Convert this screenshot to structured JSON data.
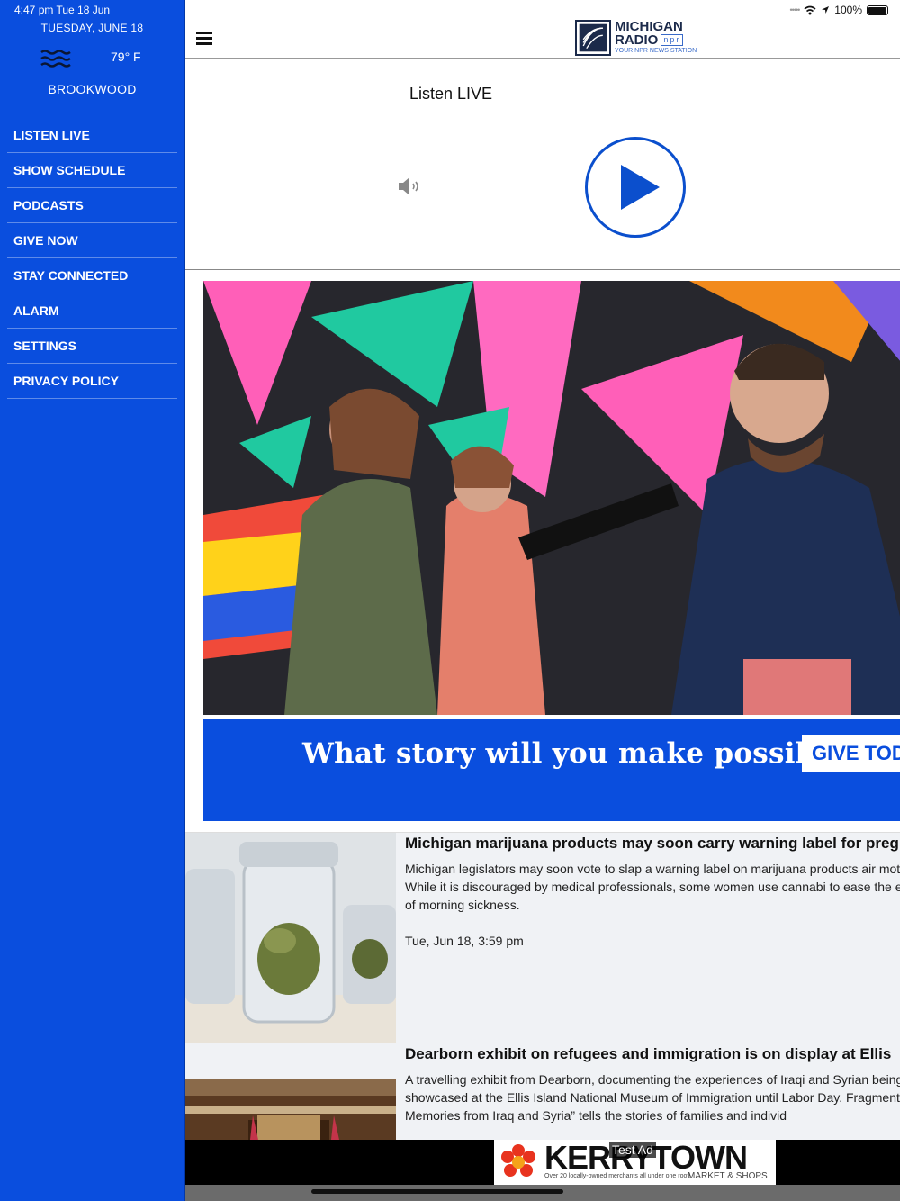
{
  "status_bar": {
    "time_date": "4:47 pm   Tue 18 Jun",
    "battery": "100%"
  },
  "sidebar": {
    "date": "TUESDAY, JUNE 18",
    "temperature": "79° F",
    "location": "BROOKWOOD",
    "weather_icon": "fog-icon",
    "menu": [
      {
        "label": "LISTEN LIVE"
      },
      {
        "label": "SHOW SCHEDULE"
      },
      {
        "label": "PODCASTS"
      },
      {
        "label": "GIVE NOW"
      },
      {
        "label": "STAY CONNECTED"
      },
      {
        "label": "ALARM"
      },
      {
        "label": "SETTINGS"
      },
      {
        "label": "PRIVACY POLICY"
      }
    ]
  },
  "header": {
    "logo_line1": "MICHIGAN",
    "logo_line2": "RADIO",
    "logo_npr": "npr",
    "logo_tagline": "YOUR NPR NEWS STATION"
  },
  "player": {
    "title": "Listen LIVE",
    "accent_color": "#0b4fcd"
  },
  "banner": {
    "headline": "What story will you make possible?",
    "button_label": "GIVE TOD"
  },
  "articles": [
    {
      "title": "Michigan marijuana products may soon carry warning label for preg",
      "summary": "Michigan legislators may soon vote to slap a warning label on marijuana products air mothers. While it is discouraged by medical professionals, some women use cannabi to ease the effects of morning sickness.",
      "date": "Tue, Jun 18, 3:59 pm"
    },
    {
      "title": "Dearborn exhibit on refugees and immigration is on display at Ellis",
      "summary": "A travelling exhibit from Dearborn, documenting the experiences of Iraqi and Syrian being showcased at the Ellis Island National Museum of Immigration until Labor Day. Fragments and Memories from Iraq and Syria” tells the stories of families and individ"
    }
  ],
  "ad": {
    "label": "Test Ad",
    "brand": "KERRYTOWN",
    "tagline": "Over 20 locally-owned merchants all under one roof!",
    "subtitle": "MARKET & SHOPS"
  }
}
